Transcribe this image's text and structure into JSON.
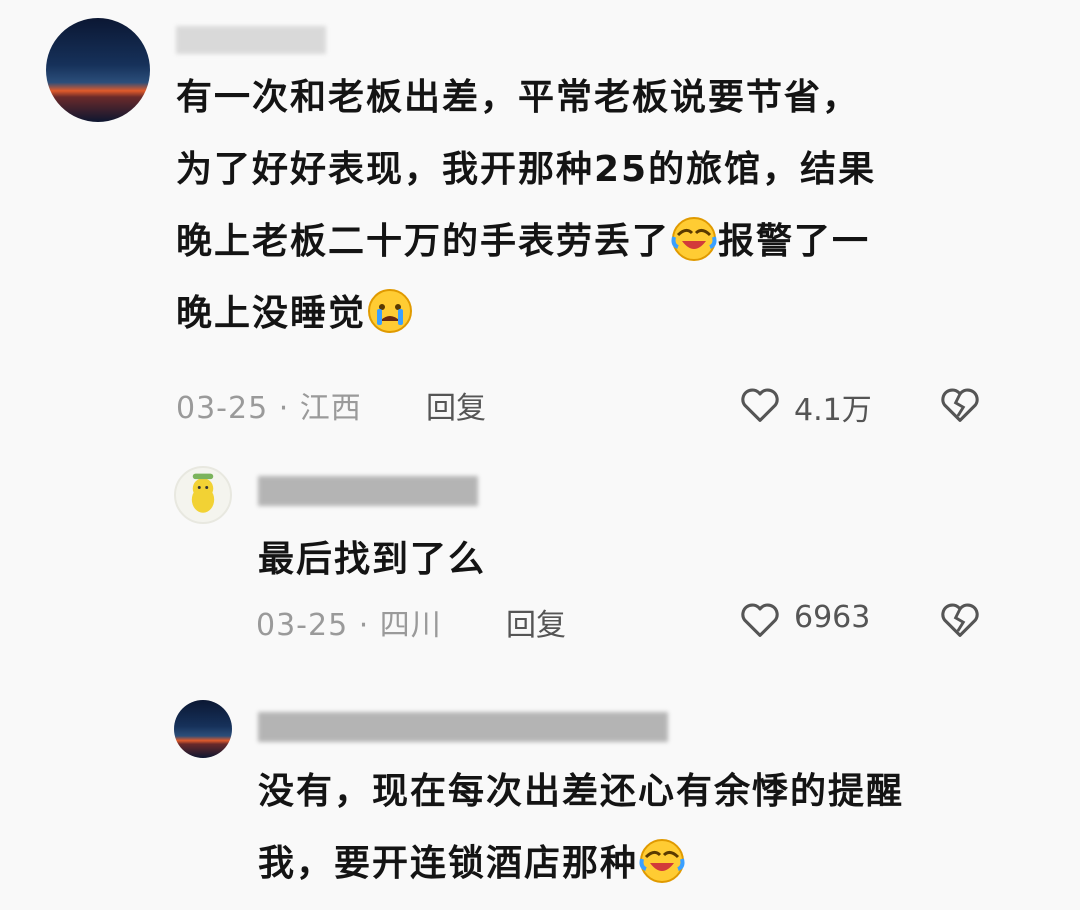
{
  "comments": [
    {
      "text_lines": [
        "有一次和老板出差，平常老板说要节省，",
        "为了好好表现，我开那种25的旅馆，结果",
        "晚上老板二十万的手表劳丢了",
        "报警了一",
        "晚上没睡觉"
      ],
      "date_location": "03-25 · 江西",
      "reply_label": "回复",
      "likes": "4.1万"
    },
    {
      "text": "最后找到了么",
      "date_location": "03-25 · 四川",
      "reply_label": "回复",
      "likes": "6963"
    },
    {
      "text_lines": [
        "没有，现在每次出差还心有余悸的提醒",
        "我，要开连锁酒店那种"
      ]
    }
  ],
  "icons": {
    "like": "heart-outline-icon",
    "dislike": "broken-heart-icon",
    "laugh_cry": "laughing-crying-emoji",
    "crying": "crying-emoji"
  }
}
